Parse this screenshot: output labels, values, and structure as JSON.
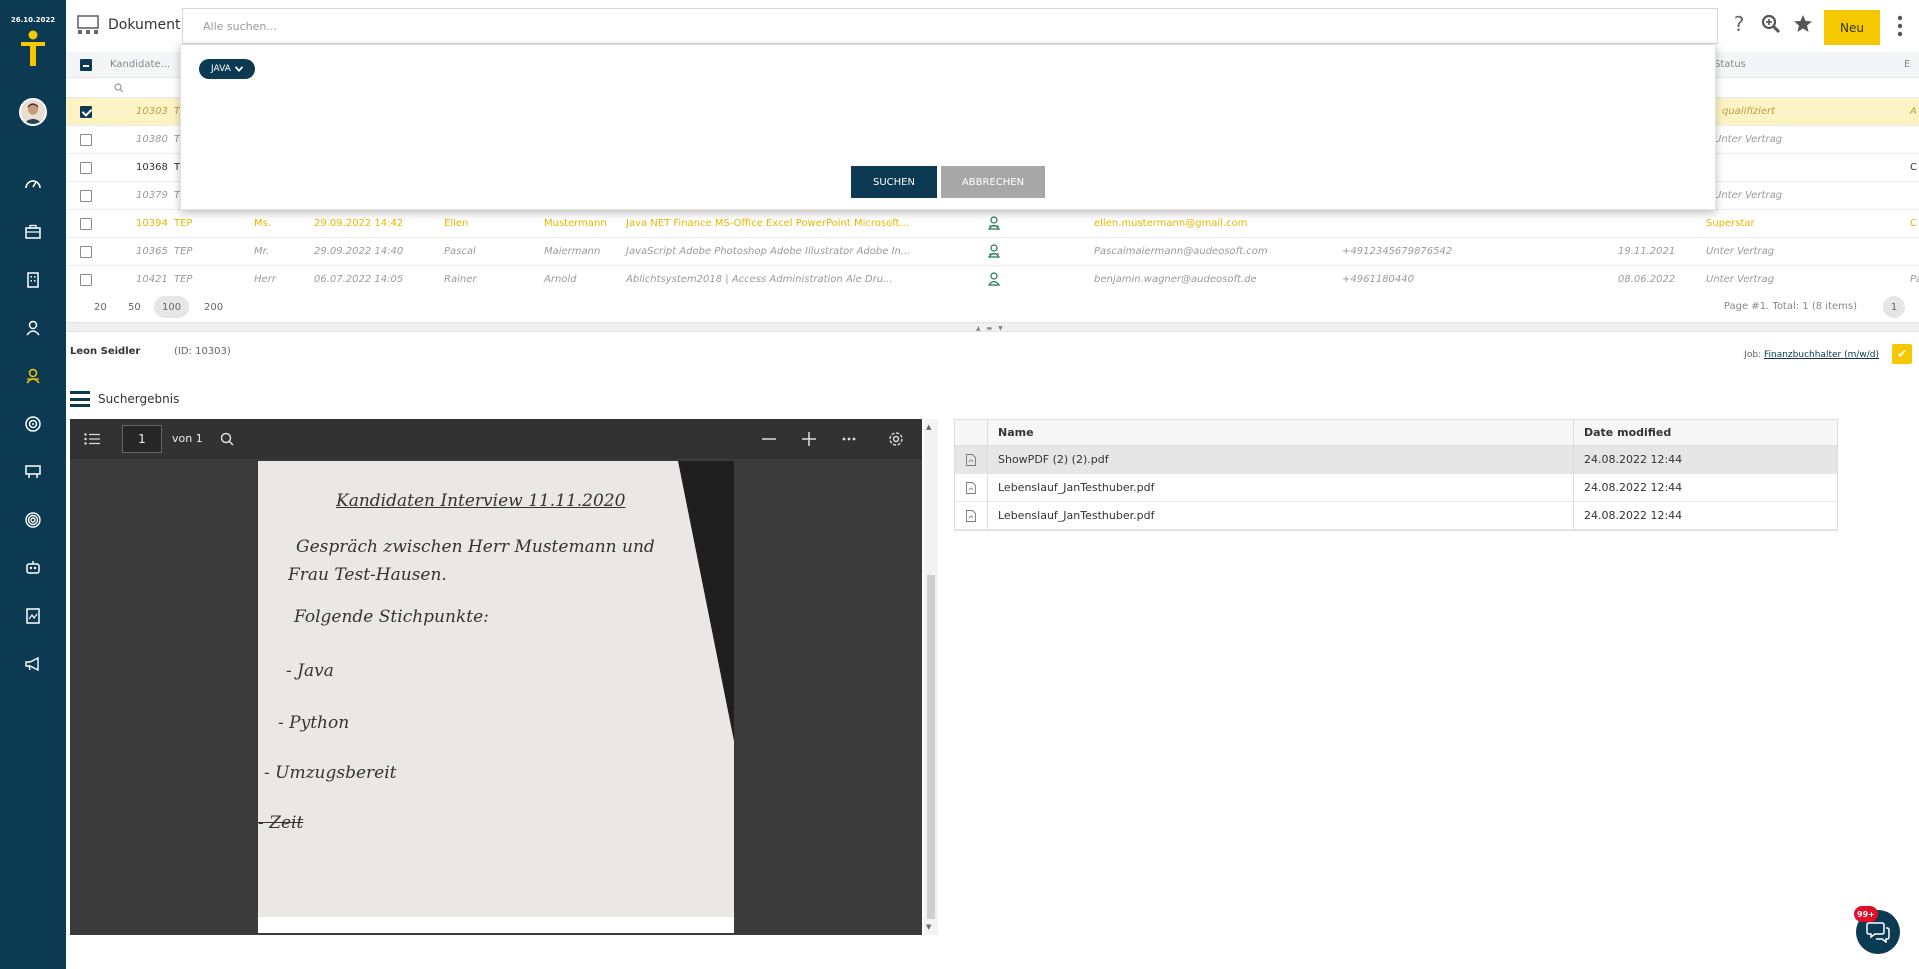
{
  "sidebar": {
    "date": "26.10.2022",
    "icons": [
      "dashboard-icon",
      "briefcase-icon",
      "building-icon",
      "person-icon",
      "candidate-icon",
      "target-icon",
      "org-chart-icon",
      "radar-icon",
      "robot-icon",
      "document-icon",
      "megaphone-icon"
    ],
    "accent": "#f6c800",
    "bg": "#0b3a52"
  },
  "topbar": {
    "title": "Dokument",
    "search_placeholder": "Alle suchen...",
    "new_label": "Neu",
    "help_glyph": "?"
  },
  "table": {
    "headers": {
      "candidate": "Kandidate...",
      "status": "Status",
      "e": "E"
    },
    "rows": [
      {
        "id": "10303",
        "c1": "T",
        "status": "qualifiziert",
        "last": "A",
        "style": "selected",
        "checked": true
      },
      {
        "id": "10380",
        "c1": "T",
        "status": "Unter Vertrag",
        "last": "",
        "style": "",
        "checked": false
      },
      {
        "id": "10368",
        "c1": "T",
        "status": "",
        "last": "C",
        "style": "plain",
        "checked": false
      },
      {
        "id": "10379",
        "c1": "T",
        "status": "Unter Vertrag",
        "last": "",
        "style": "",
        "checked": false
      },
      {
        "id": "10394",
        "c1": "TEP",
        "salutation": "Ms.",
        "date": "29.09.2022 14:42",
        "first": "Ellen",
        "lastname": "Mustermann",
        "skills": "Java NET Finance MS-Office Excel PowerPoint Microsoft...",
        "email": "ellen.mustermann@gmail.com",
        "phone": "",
        "birth": "",
        "status": "Superstar",
        "last": "C",
        "style": "yellow",
        "checked": false
      },
      {
        "id": "10365",
        "c1": "TEP",
        "salutation": "Mr.",
        "date": "29.09.2022 14:40",
        "first": "Pascal",
        "lastname": "Maiermann",
        "skills": "JavaScript Adobe Photoshop Adobe Illustrator Adobe In...",
        "email": "Pascalmaiermann@audeosoft.com",
        "phone": "+4912345679876542",
        "birth": "19.11.2021",
        "status": "Unter Vertrag",
        "last": "",
        "style": "",
        "checked": false
      },
      {
        "id": "10421",
        "c1": "TEP",
        "salutation": "Herr",
        "date": "06.07.2022 14:05",
        "first": "Rainer",
        "lastname": "Arnold",
        "skills": "Ablichtsystem2018 | Access Administration Ale Dru...",
        "email": "benjamin.wagner@audeosoft.de",
        "phone": "+4961180440",
        "birth": "08.06.2022",
        "status": "Unter Vertrag",
        "last": "Pa",
        "style": "",
        "checked": false
      }
    ]
  },
  "pager": {
    "sizes": [
      "20",
      "50",
      "100",
      "200"
    ],
    "active": "100",
    "info": "Page #1. Total: 1 (8 items)",
    "page": "1"
  },
  "overlay": {
    "chip": "JAVA",
    "search_label": "SUCHEN",
    "cancel_label": "ABBRECHEN"
  },
  "detail": {
    "name": "Leon Seidler",
    "id_text": "(ID: 10303)",
    "job_label": "Job:",
    "job_link": "Finanzbuchhalter (m/w/d)",
    "result_title": "Suchergebnis"
  },
  "pdf": {
    "page_value": "1",
    "of_label": "von 1",
    "lines": [
      "Kandidaten Interview 11.11.2020",
      "Gespräch zwischen Herr Mustemann und",
      "Frau Test-Hausen.",
      "Folgende Stichpunkte:",
      "- Java",
      "- Python",
      "- Umzugsbereit",
      "- Zeit"
    ]
  },
  "files": {
    "headers": {
      "name": "Name",
      "date": "Date modified"
    },
    "rows": [
      {
        "name": "ShowPDF (2) (2).pdf",
        "date": "24.08.2022 12:44"
      },
      {
        "name": "Lebenslauf_JanTesthuber.pdf",
        "date": "24.08.2022 12:44"
      },
      {
        "name": "Lebenslauf_JanTesthuber.pdf",
        "date": "24.08.2022 12:44"
      }
    ]
  },
  "chat": {
    "badge": "99+"
  }
}
